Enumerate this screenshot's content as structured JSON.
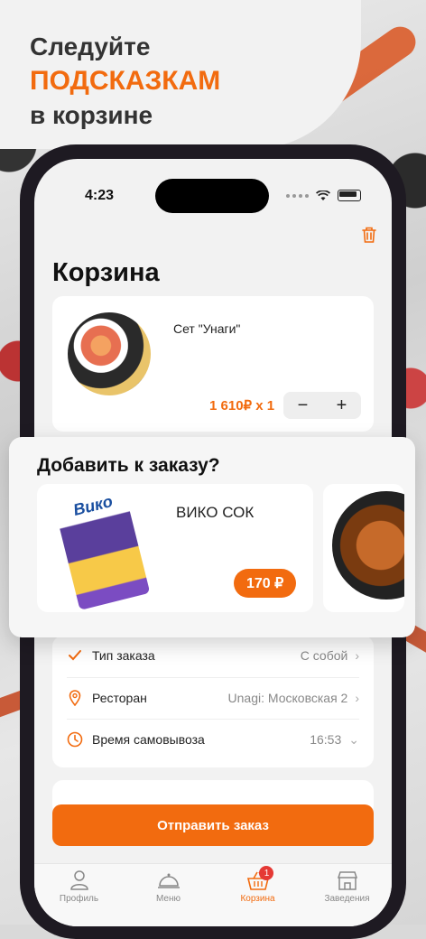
{
  "promo": {
    "line1": "Следуйте",
    "line2": "ПОДСКАЗКАМ",
    "line3": "в корзине"
  },
  "status_bar": {
    "time": "4:23"
  },
  "cart": {
    "title": "Корзина",
    "item": {
      "name": "Сет \"Унаги\"",
      "price_qty": "1 610₽ x 1",
      "minus": "−",
      "plus": "+"
    }
  },
  "upsell": {
    "title": "Добавить к заказу?",
    "items": [
      {
        "brand": "Вико",
        "name": "ВИКО СОК",
        "price": "170 ₽"
      }
    ]
  },
  "order": {
    "rows": [
      {
        "label": "Тип заказа",
        "value": "С собой",
        "icon": "check-icon"
      },
      {
        "label": "Ресторан",
        "value": "Unagi: Московская 2",
        "icon": "location-pin-icon"
      },
      {
        "label": "Время самовывоза",
        "value": "16:53",
        "icon": "clock-icon"
      }
    ]
  },
  "submit_label": "Отправить заказ",
  "tabs": [
    {
      "label": "Профиль",
      "icon": "person-icon"
    },
    {
      "label": "Меню",
      "icon": "cloche-icon"
    },
    {
      "label": "Корзина",
      "icon": "basket-icon",
      "active": true,
      "badge": "1"
    },
    {
      "label": "Заведения",
      "icon": "storefront-icon"
    }
  ],
  "colors": {
    "accent": "#f26b0f",
    "badge": "#e53935"
  }
}
